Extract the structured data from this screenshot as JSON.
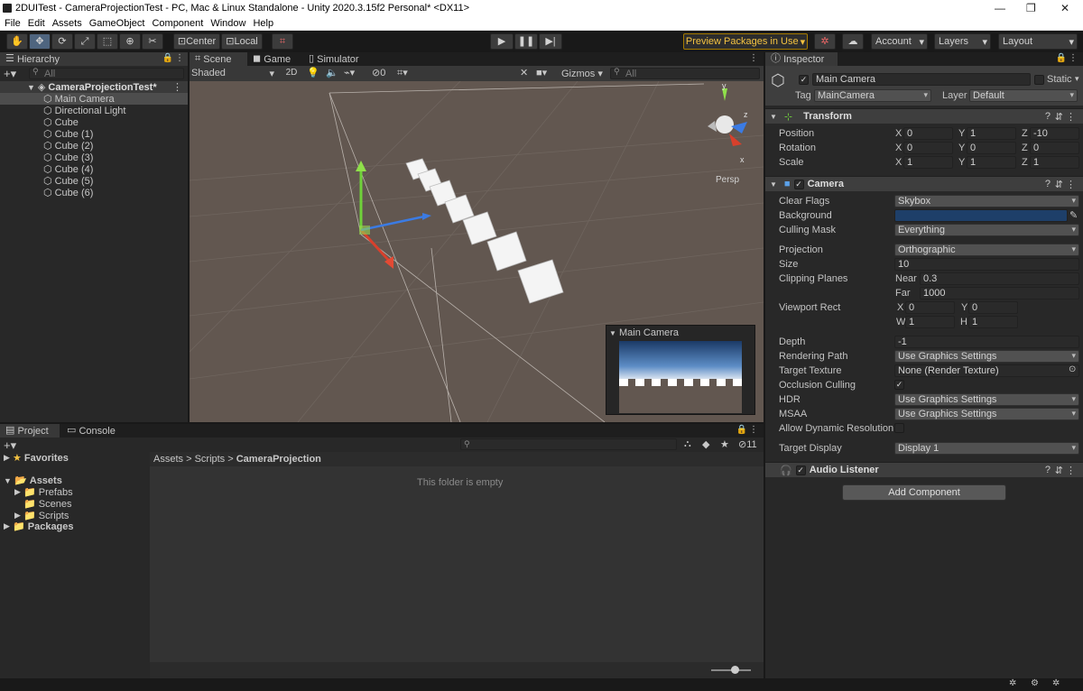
{
  "window": {
    "title": "2DUITest - CameraProjectionTest - PC, Mac & Linux Standalone - Unity 2020.3.15f2 Personal* <DX11>"
  },
  "menu": [
    "File",
    "Edit",
    "Assets",
    "GameObject",
    "Component",
    "Window",
    "Help"
  ],
  "toolbar": {
    "center": "Center",
    "local": "Local",
    "preview": "Preview Packages in Use",
    "account": "Account",
    "layers": "Layers",
    "layout": "Layout"
  },
  "hierarchy": {
    "tab": "Hierarchy",
    "search_placeholder": "All",
    "scene": "CameraProjectionTest*",
    "items": [
      "Main Camera",
      "Directional Light",
      "Cube",
      "Cube (1)",
      "Cube (2)",
      "Cube (3)",
      "Cube (4)",
      "Cube (5)",
      "Cube (6)"
    ]
  },
  "scene": {
    "tabs": [
      "Scene",
      "Game",
      "Simulator"
    ],
    "shading": "Shaded",
    "mode2d": "2D",
    "hidden_count": "0",
    "gizmos": "Gizmos",
    "search_placeholder": "All",
    "persp": "Persp",
    "gizmo_axes": {
      "x": "x",
      "y": "y",
      "z": "z"
    },
    "preview_title": "Main Camera"
  },
  "project": {
    "tabs": [
      "Project",
      "Console"
    ],
    "favorites": "Favorites",
    "assets": "Assets",
    "folders": [
      "Prefabs",
      "Scenes",
      "Scripts"
    ],
    "packages": "Packages",
    "breadcrumb": [
      "Assets",
      "Scripts",
      "CameraProjection"
    ],
    "empty": "This folder is empty",
    "count": "11"
  },
  "inspector": {
    "tab": "Inspector",
    "object_name": "Main Camera",
    "static": "Static",
    "tag_label": "Tag",
    "tag": "MainCamera",
    "layer_label": "Layer",
    "layer": "Default",
    "transform": {
      "title": "Transform",
      "rows": [
        {
          "label": "Position",
          "x": "0",
          "y": "1",
          "z": "-10"
        },
        {
          "label": "Rotation",
          "x": "0",
          "y": "0",
          "z": "0"
        },
        {
          "label": "Scale",
          "x": "1",
          "y": "1",
          "z": "1"
        }
      ]
    },
    "camera": {
      "title": "Camera",
      "clear_flags_label": "Clear Flags",
      "clear_flags": "Skybox",
      "background_label": "Background",
      "background_color": "#1e3f69",
      "culling_label": "Culling Mask",
      "culling": "Everything",
      "projection_label": "Projection",
      "projection": "Orthographic",
      "size_label": "Size",
      "size": "10",
      "clip_label": "Clipping Planes",
      "near_label": "Near",
      "near": "0.3",
      "far_label": "Far",
      "far": "1000",
      "viewport_label": "Viewport Rect",
      "vx": "0",
      "vy": "0",
      "vw": "1",
      "vh": "1",
      "depth_label": "Depth",
      "depth": "-1",
      "render_path_label": "Rendering Path",
      "render_path": "Use Graphics Settings",
      "target_tex_label": "Target Texture",
      "target_tex": "None (Render Texture)",
      "occlusion_label": "Occlusion Culling",
      "hdr_label": "HDR",
      "hdr": "Use Graphics Settings",
      "msaa_label": "MSAA",
      "msaa": "Use Graphics Settings",
      "dyn_res_label": "Allow Dynamic Resolution",
      "target_display_label": "Target Display",
      "target_display": "Display 1"
    },
    "audio_listener": "Audio Listener",
    "add_component": "Add Component"
  },
  "colors": {
    "accent": "#4f657f",
    "panel": "#282828",
    "scene_bg": "#625750"
  }
}
